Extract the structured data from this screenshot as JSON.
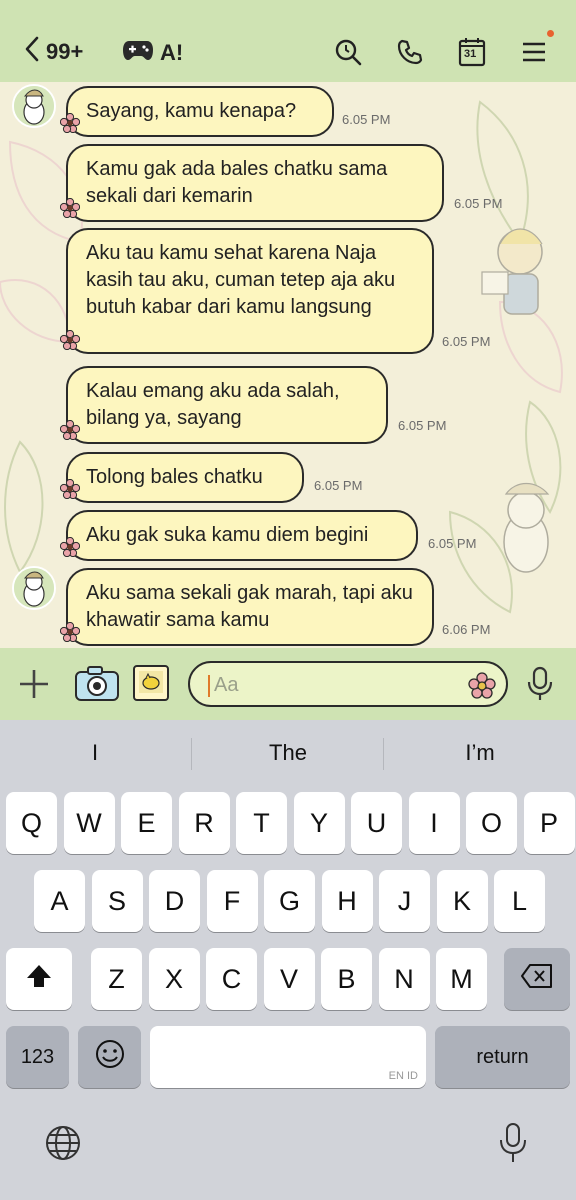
{
  "header": {
    "back_count": "99+",
    "chat_title": "A!",
    "title_icon": "game-controller-icon",
    "icons": [
      "search-icon",
      "phone-icon",
      "calendar-icon",
      "menu-icon"
    ],
    "calendar_day": "31"
  },
  "messages": [
    {
      "text": "Sayang, kamu kenapa?",
      "time": "6.05 PM",
      "avatar": true
    },
    {
      "text": "Kamu gak ada bales chatku sama sekali dari kemarin",
      "time": "6.05 PM",
      "avatar": false
    },
    {
      "text": "Aku tau kamu sehat karena Naja kasih tau aku, cuman tetep aja aku butuh kabar dari kamu langsung",
      "time": "6.05 PM",
      "avatar": false
    },
    {
      "text": "Kalau emang aku ada salah, bilang ya, sayang",
      "time": "6.05 PM",
      "avatar": false
    },
    {
      "text": "Tolong bales chatku",
      "time": "6.05 PM",
      "avatar": false
    },
    {
      "text": "Aku gak suka kamu diem begini",
      "time": "6.05 PM",
      "avatar": false
    },
    {
      "text": "Aku sama sekali gak marah, tapi aku khawatir sama kamu",
      "time": "6.06 PM",
      "avatar": true
    }
  ],
  "input": {
    "placeholder": "Aa"
  },
  "keyboard": {
    "suggestions": [
      "I",
      "The",
      "I’m"
    ],
    "row1": [
      "Q",
      "W",
      "E",
      "R",
      "T",
      "Y",
      "U",
      "I",
      "O",
      "P"
    ],
    "row2": [
      "A",
      "S",
      "D",
      "F",
      "G",
      "H",
      "J",
      "K",
      "L"
    ],
    "row3": [
      "Z",
      "X",
      "C",
      "V",
      "B",
      "N",
      "M"
    ],
    "numbers_key": "123",
    "return_key": "return",
    "space_lang": "EN ID"
  },
  "colors": {
    "header": "#cfe3b3",
    "bubble": "#fdf6bf",
    "chat_bg": "#f3efd9"
  }
}
